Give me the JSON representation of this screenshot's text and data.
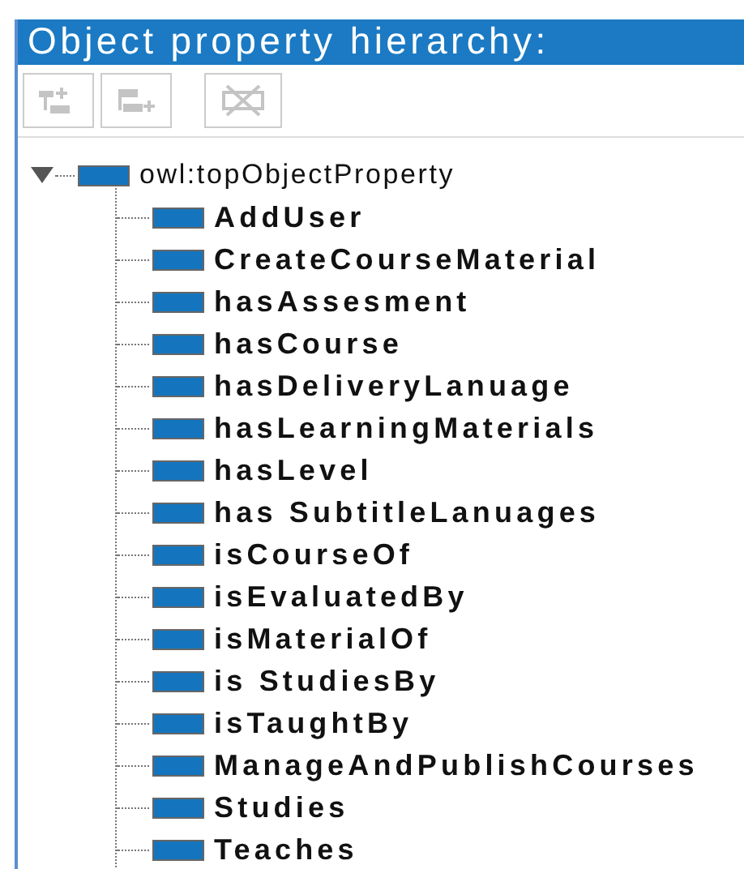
{
  "panel": {
    "title": "Object property hierarchy:"
  },
  "toolbar": [
    {
      "kind": "add-sub",
      "disabled": true
    },
    {
      "kind": "add-sibling",
      "disabled": true
    },
    {
      "kind": "delete",
      "disabled": true
    }
  ],
  "tree": {
    "label": "owl:topObjectProperty",
    "expanded": true,
    "children": [
      {
        "label": "AddUser"
      },
      {
        "label": "CreateCourseMaterial"
      },
      {
        "label": "hasAssesment"
      },
      {
        "label": "hasCourse"
      },
      {
        "label": "hasDeliveryLanuage"
      },
      {
        "label": "hasLearningMaterials"
      },
      {
        "label": "hasLevel"
      },
      {
        "label": "has SubtitleLanuages"
      },
      {
        "label": "isCourseOf"
      },
      {
        "label": "isEvaluatedBy"
      },
      {
        "label": "isMaterialOf"
      },
      {
        "label": "is StudiesBy"
      },
      {
        "label": "isTaughtBy"
      },
      {
        "label": "ManageAndPublishCourses"
      },
      {
        "label": "Studies"
      },
      {
        "label": "Teaches"
      }
    ]
  }
}
